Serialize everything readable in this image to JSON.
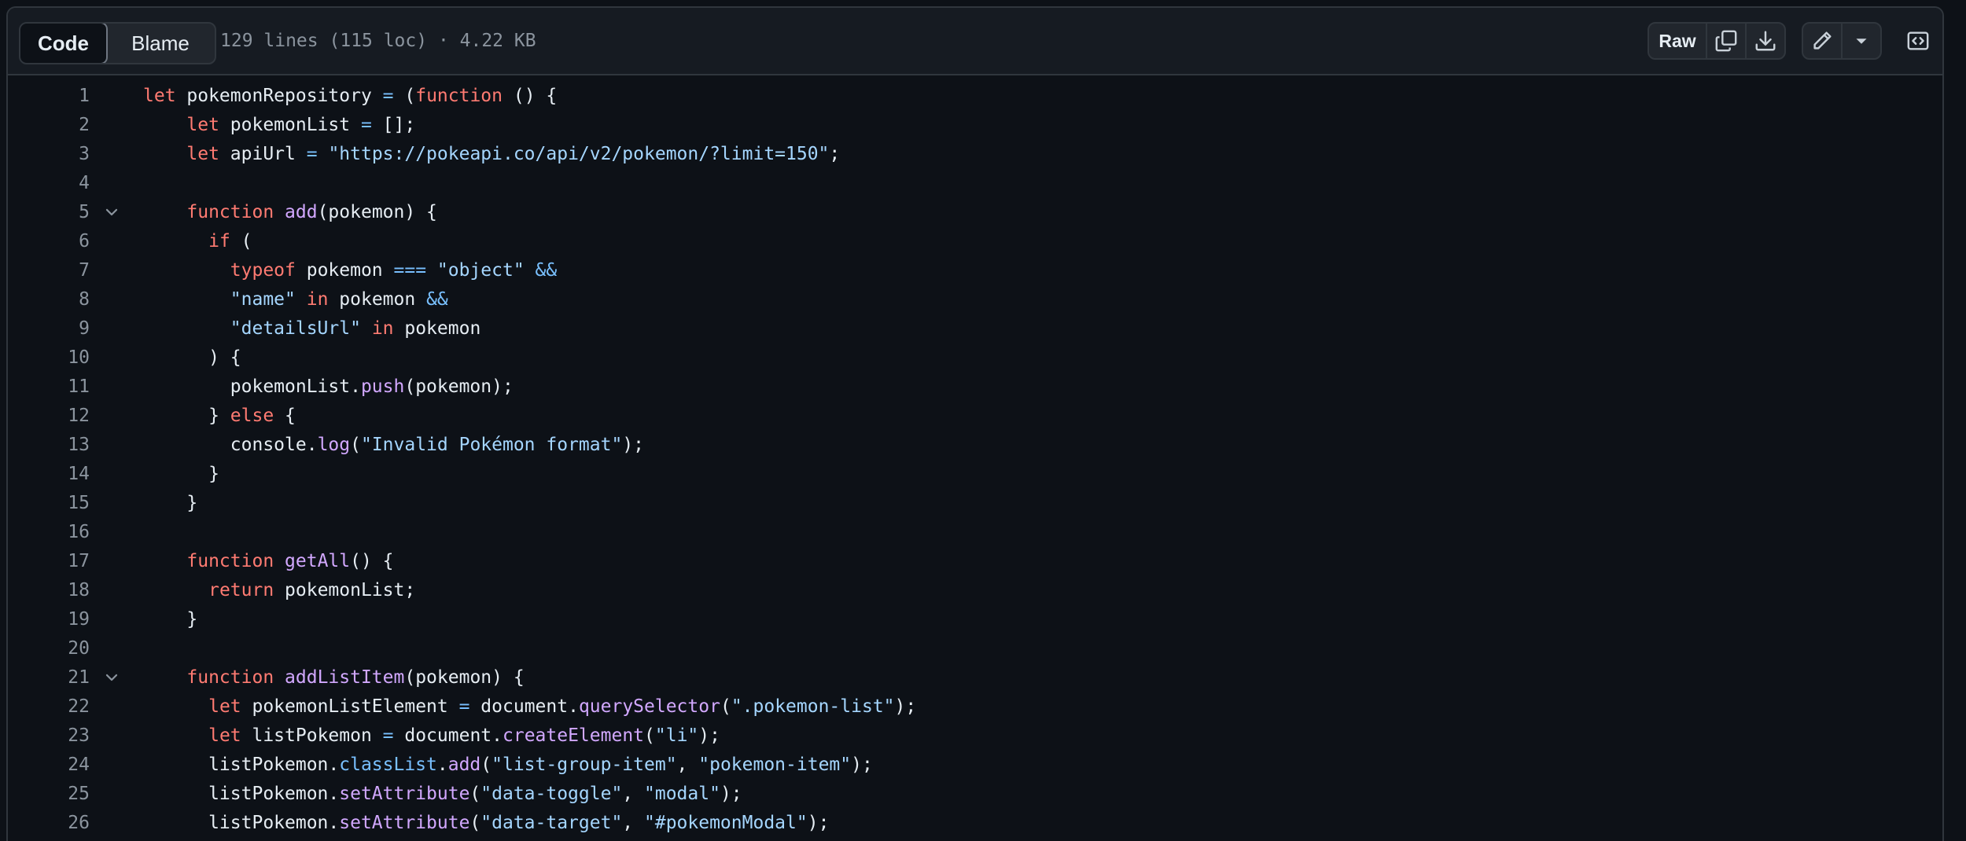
{
  "toolbar": {
    "tabs": [
      {
        "label": "Code",
        "active": true
      },
      {
        "label": "Blame",
        "active": false
      }
    ],
    "file_info": "129 lines (115 loc) · 4.22 KB",
    "raw_label": "Raw",
    "icons": [
      "copy-icon",
      "download-icon",
      "pencil-icon",
      "triangle-down-icon",
      "code-square-icon"
    ]
  },
  "code": {
    "lines": [
      {
        "n": "1",
        "fold": false,
        "tokens": [
          [
            "kw",
            "let"
          ],
          [
            "p",
            " pokemonRepository "
          ],
          [
            "op",
            "="
          ],
          [
            "p",
            " ("
          ],
          [
            "kw",
            "function"
          ],
          [
            "p",
            " () {"
          ]
        ]
      },
      {
        "n": "2",
        "fold": false,
        "tokens": [
          [
            "p",
            "    "
          ],
          [
            "kw",
            "let"
          ],
          [
            "p",
            " pokemonList "
          ],
          [
            "op",
            "="
          ],
          [
            "p",
            " [];"
          ]
        ]
      },
      {
        "n": "3",
        "fold": false,
        "tokens": [
          [
            "p",
            "    "
          ],
          [
            "kw",
            "let"
          ],
          [
            "p",
            " apiUrl "
          ],
          [
            "op",
            "="
          ],
          [
            "p",
            " "
          ],
          [
            "str",
            "\"https://pokeapi.co/api/v2/pokemon/?limit=150\""
          ],
          [
            "p",
            ";"
          ]
        ]
      },
      {
        "n": "4",
        "fold": false,
        "tokens": []
      },
      {
        "n": "5",
        "fold": true,
        "tokens": [
          [
            "p",
            "    "
          ],
          [
            "kw",
            "function"
          ],
          [
            "p",
            " "
          ],
          [
            "fn",
            "add"
          ],
          [
            "p",
            "(pokemon) {"
          ]
        ]
      },
      {
        "n": "6",
        "fold": false,
        "tokens": [
          [
            "p",
            "      "
          ],
          [
            "kw",
            "if"
          ],
          [
            "p",
            " ("
          ]
        ]
      },
      {
        "n": "7",
        "fold": false,
        "tokens": [
          [
            "p",
            "        "
          ],
          [
            "kw",
            "typeof"
          ],
          [
            "p",
            " pokemon "
          ],
          [
            "op",
            "==="
          ],
          [
            "p",
            " "
          ],
          [
            "str",
            "\"object\""
          ],
          [
            "p",
            " "
          ],
          [
            "op",
            "&&"
          ]
        ]
      },
      {
        "n": "8",
        "fold": false,
        "tokens": [
          [
            "p",
            "        "
          ],
          [
            "str",
            "\"name\""
          ],
          [
            "p",
            " "
          ],
          [
            "kw",
            "in"
          ],
          [
            "p",
            " pokemon "
          ],
          [
            "op",
            "&&"
          ]
        ]
      },
      {
        "n": "9",
        "fold": false,
        "tokens": [
          [
            "p",
            "        "
          ],
          [
            "str",
            "\"detailsUrl\""
          ],
          [
            "p",
            " "
          ],
          [
            "kw",
            "in"
          ],
          [
            "p",
            " pokemon"
          ]
        ]
      },
      {
        "n": "10",
        "fold": false,
        "tokens": [
          [
            "p",
            "      ) {"
          ]
        ]
      },
      {
        "n": "11",
        "fold": false,
        "tokens": [
          [
            "p",
            "        pokemonList."
          ],
          [
            "fn",
            "push"
          ],
          [
            "p",
            "(pokemon);"
          ]
        ]
      },
      {
        "n": "12",
        "fold": false,
        "tokens": [
          [
            "p",
            "      } "
          ],
          [
            "kw",
            "else"
          ],
          [
            "p",
            " {"
          ]
        ]
      },
      {
        "n": "13",
        "fold": false,
        "tokens": [
          [
            "p",
            "        console."
          ],
          [
            "fn",
            "log"
          ],
          [
            "p",
            "("
          ],
          [
            "str",
            "\"Invalid Pokémon format\""
          ],
          [
            "p",
            ");"
          ]
        ]
      },
      {
        "n": "14",
        "fold": false,
        "tokens": [
          [
            "p",
            "      }"
          ]
        ]
      },
      {
        "n": "15",
        "fold": false,
        "tokens": [
          [
            "p",
            "    }"
          ]
        ]
      },
      {
        "n": "16",
        "fold": false,
        "tokens": []
      },
      {
        "n": "17",
        "fold": false,
        "tokens": [
          [
            "p",
            "    "
          ],
          [
            "kw",
            "function"
          ],
          [
            "p",
            " "
          ],
          [
            "fn",
            "getAll"
          ],
          [
            "p",
            "() {"
          ]
        ]
      },
      {
        "n": "18",
        "fold": false,
        "tokens": [
          [
            "p",
            "      "
          ],
          [
            "kw",
            "return"
          ],
          [
            "p",
            " pokemonList;"
          ]
        ]
      },
      {
        "n": "19",
        "fold": false,
        "tokens": [
          [
            "p",
            "    }"
          ]
        ]
      },
      {
        "n": "20",
        "fold": false,
        "tokens": []
      },
      {
        "n": "21",
        "fold": true,
        "tokens": [
          [
            "p",
            "    "
          ],
          [
            "kw",
            "function"
          ],
          [
            "p",
            " "
          ],
          [
            "fn",
            "addListItem"
          ],
          [
            "p",
            "(pokemon) {"
          ]
        ]
      },
      {
        "n": "22",
        "fold": false,
        "tokens": [
          [
            "p",
            "      "
          ],
          [
            "kw",
            "let"
          ],
          [
            "p",
            " pokemonListElement "
          ],
          [
            "op",
            "="
          ],
          [
            "p",
            " document."
          ],
          [
            "fn",
            "querySelector"
          ],
          [
            "p",
            "("
          ],
          [
            "str",
            "\".pokemon-list\""
          ],
          [
            "p",
            ");"
          ]
        ]
      },
      {
        "n": "23",
        "fold": false,
        "tokens": [
          [
            "p",
            "      "
          ],
          [
            "kw",
            "let"
          ],
          [
            "p",
            " listPokemon "
          ],
          [
            "op",
            "="
          ],
          [
            "p",
            " document."
          ],
          [
            "fn",
            "createElement"
          ],
          [
            "p",
            "("
          ],
          [
            "str",
            "\"li\""
          ],
          [
            "p",
            ");"
          ]
        ]
      },
      {
        "n": "24",
        "fold": false,
        "tokens": [
          [
            "p",
            "      listPokemon."
          ],
          [
            "op",
            "classList"
          ],
          [
            "p",
            "."
          ],
          [
            "fn",
            "add"
          ],
          [
            "p",
            "("
          ],
          [
            "str",
            "\"list-group-item\""
          ],
          [
            "p",
            ", "
          ],
          [
            "str",
            "\"pokemon-item\""
          ],
          [
            "p",
            ");"
          ]
        ]
      },
      {
        "n": "25",
        "fold": false,
        "tokens": [
          [
            "p",
            "      listPokemon."
          ],
          [
            "fn",
            "setAttribute"
          ],
          [
            "p",
            "("
          ],
          [
            "str",
            "\"data-toggle\""
          ],
          [
            "p",
            ", "
          ],
          [
            "str",
            "\"modal\""
          ],
          [
            "p",
            ");"
          ]
        ]
      },
      {
        "n": "26",
        "fold": false,
        "tokens": [
          [
            "p",
            "      listPokemon."
          ],
          [
            "fn",
            "setAttribute"
          ],
          [
            "p",
            "("
          ],
          [
            "str",
            "\"data-target\""
          ],
          [
            "p",
            ", "
          ],
          [
            "str",
            "\"#pokemonModal\""
          ],
          [
            "p",
            ");"
          ]
        ]
      }
    ]
  },
  "colors": {
    "background": "#0d1117",
    "keyword": "#ff7b72",
    "function": "#d2a8ff",
    "string": "#a5d6ff",
    "operator": "#79c0ff",
    "line_number": "#8b949e"
  }
}
